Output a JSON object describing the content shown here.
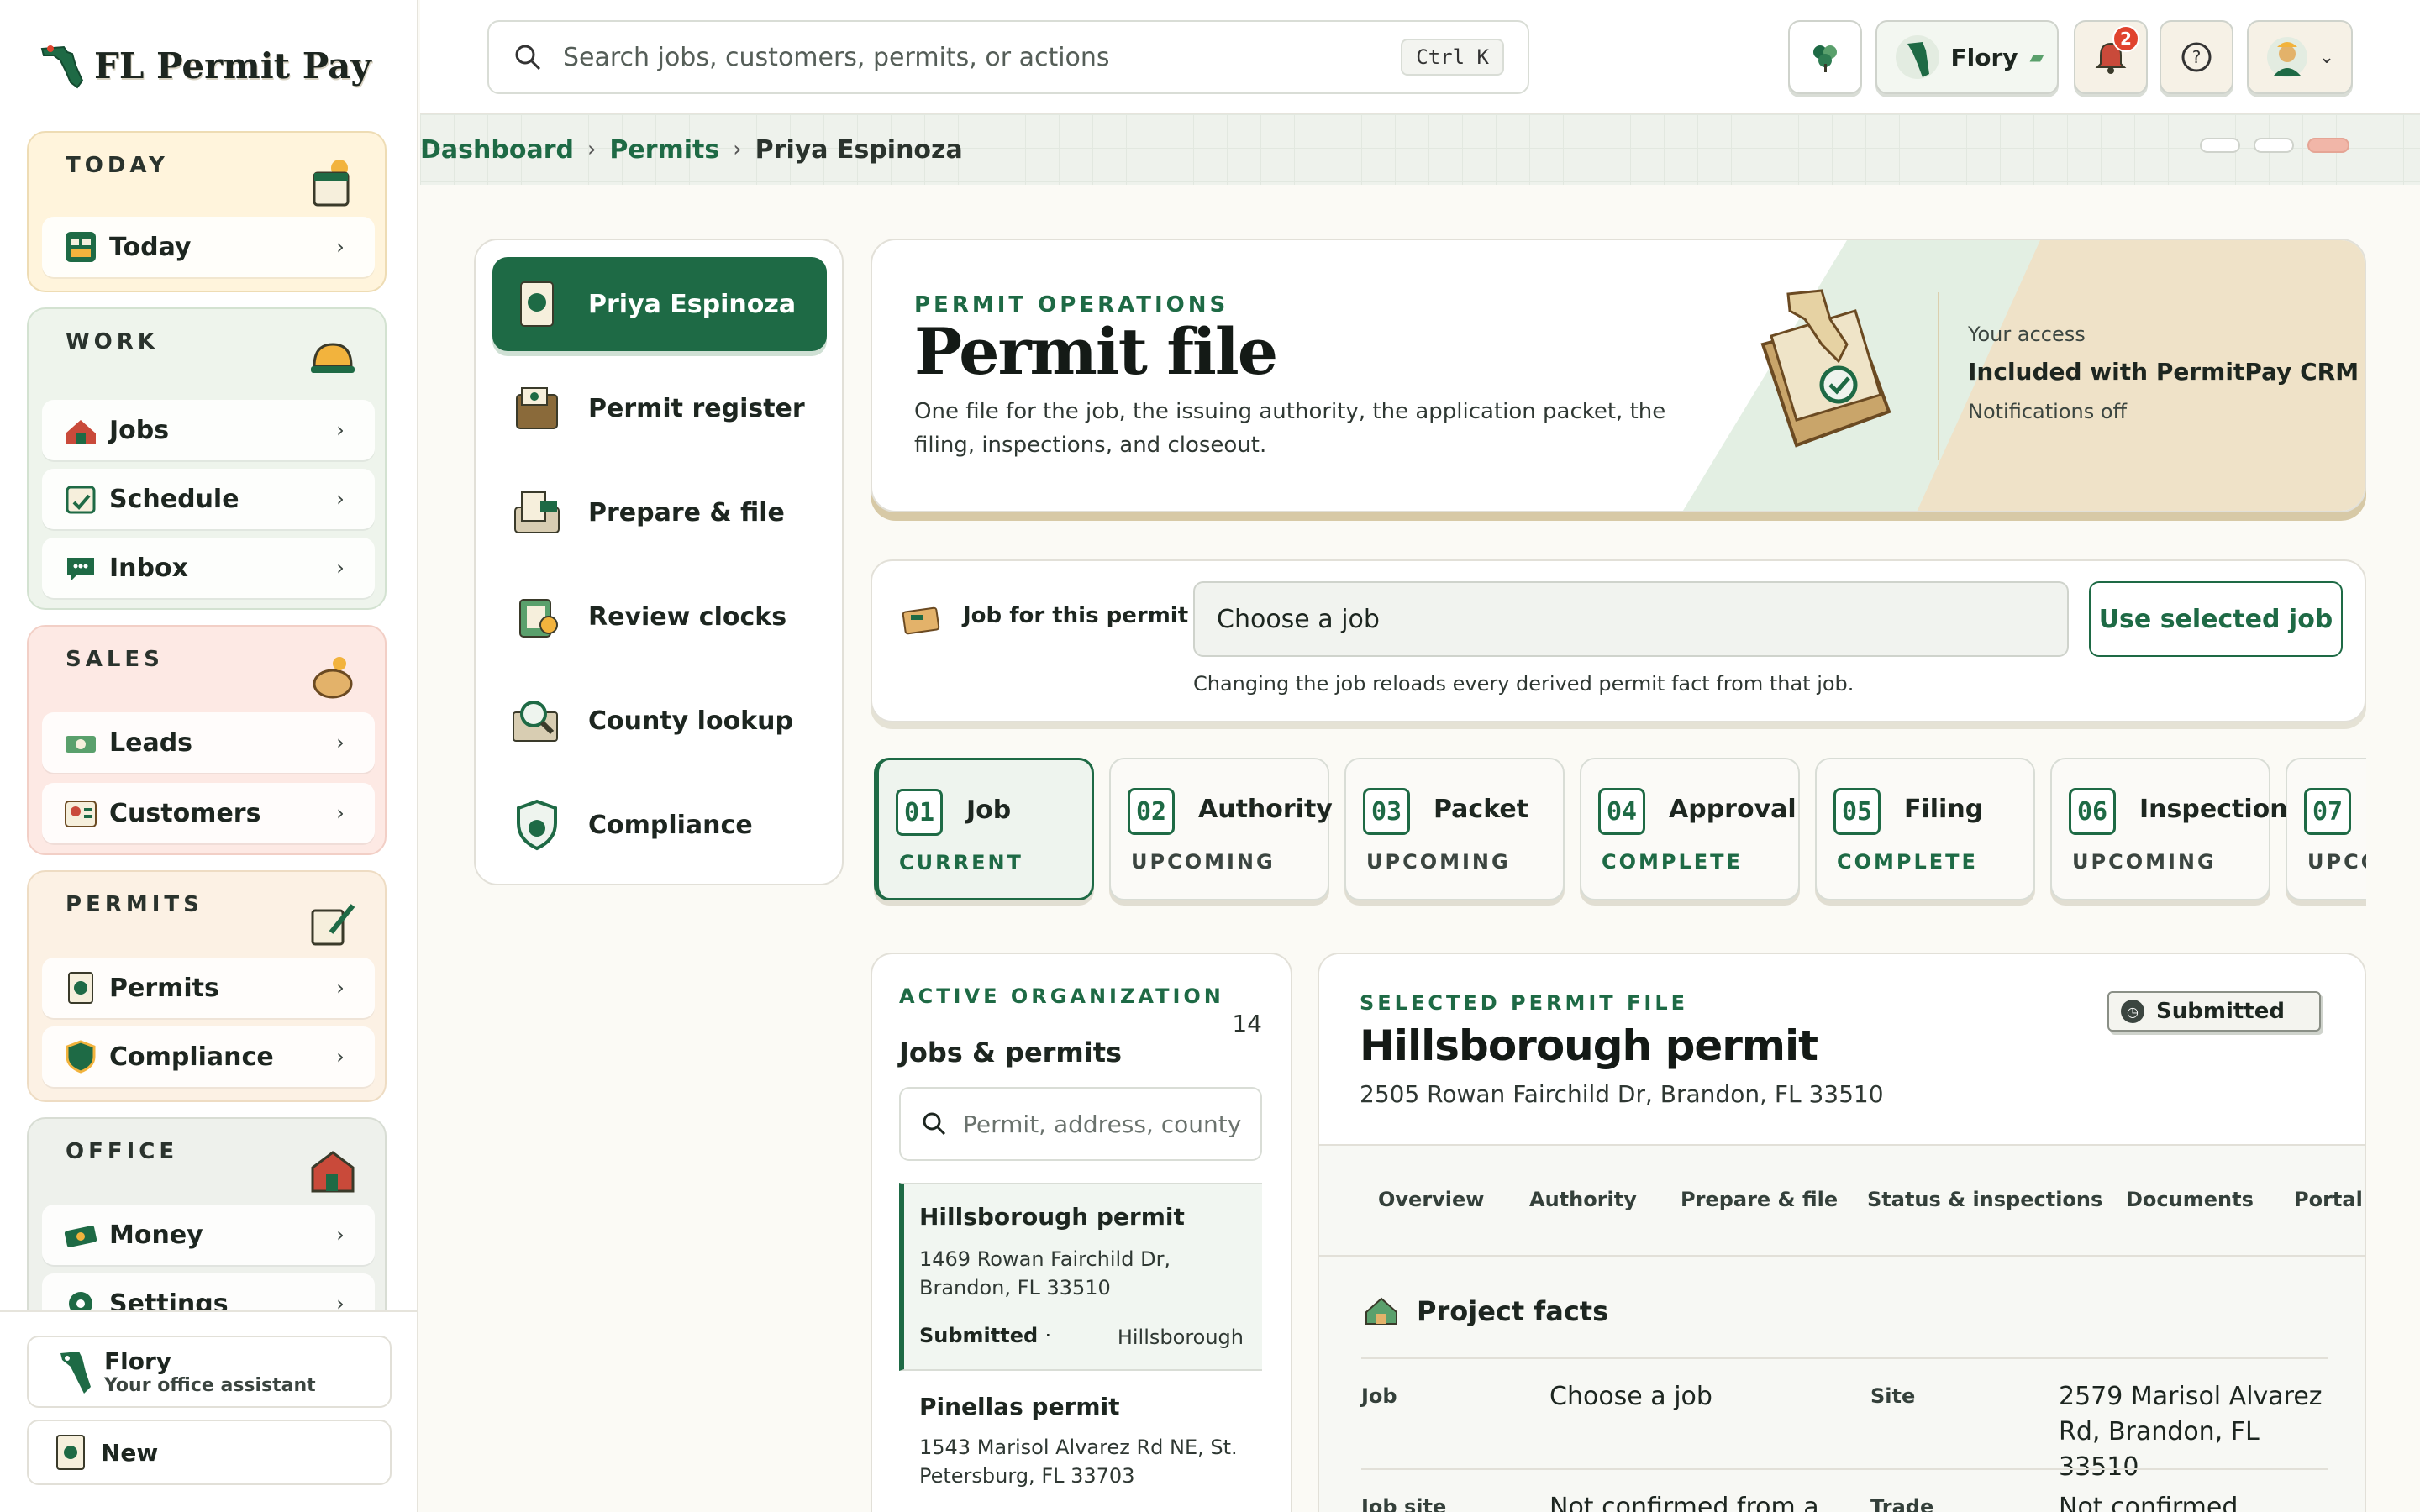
{
  "app": {
    "name": "FL Permit Pay"
  },
  "sidebar": {
    "groups": [
      {
        "title": "TODAY",
        "items": [
          {
            "label": "Today"
          }
        ]
      },
      {
        "title": "WORK",
        "items": [
          {
            "label": "Jobs"
          },
          {
            "label": "Schedule"
          },
          {
            "label": "Inbox"
          }
        ]
      },
      {
        "title": "SALES",
        "items": [
          {
            "label": "Leads"
          },
          {
            "label": "Customers"
          }
        ]
      },
      {
        "title": "PERMITS",
        "items": [
          {
            "label": "Permits"
          },
          {
            "label": "Compliance"
          }
        ]
      },
      {
        "title": "OFFICE",
        "items": [
          {
            "label": "Money"
          },
          {
            "label": "Settings"
          }
        ]
      }
    ],
    "assistant": {
      "name": "Flory",
      "subtitle": "Your office assistant"
    },
    "new_label": "New"
  },
  "topbar": {
    "search_placeholder": "Search jobs, customers, permits, or actions",
    "shortcut": "Ctrl K",
    "assistant_label": "Flory",
    "notification_count": "2"
  },
  "breadcrumb": {
    "items": [
      "Dashboard",
      "Permits"
    ],
    "current": "Priya Espinoza"
  },
  "subnav": {
    "items": [
      {
        "label": "Priya Espinoza",
        "active": true
      },
      {
        "label": "Permit register"
      },
      {
        "label": "Prepare & file"
      },
      {
        "label": "Review clocks"
      },
      {
        "label": "County lookup"
      },
      {
        "label": "Compliance"
      }
    ]
  },
  "hero": {
    "eyebrow": "PERMIT OPERATIONS",
    "title": "Permit file",
    "description": "One file for the job, the issuing authority, the application packet, the filing, inspections, and closeout.",
    "access_label": "Your access",
    "access_value": "Included with PermitPay CRM",
    "notifications": "Notifications off"
  },
  "job_selector": {
    "label": "Job for this permit",
    "value": "Choose a job",
    "button": "Use selected job",
    "hint": "Changing the job reloads every derived permit fact from that job."
  },
  "steps": [
    {
      "num": "01",
      "title": "Job",
      "status": "CURRENT"
    },
    {
      "num": "02",
      "title": "Authority",
      "status": "UPCOMING"
    },
    {
      "num": "03",
      "title": "Packet",
      "status": "UPCOMING"
    },
    {
      "num": "04",
      "title": "Approval",
      "status": "COMPLETE"
    },
    {
      "num": "05",
      "title": "Filing",
      "status": "COMPLETE"
    },
    {
      "num": "06",
      "title": "Inspection",
      "status": "UPCOMING"
    },
    {
      "num": "07",
      "title": "",
      "status": "UPCO"
    }
  ],
  "jobs_list": {
    "eyebrow": "ACTIVE ORGANIZATION",
    "title": "Jobs & permits",
    "count": "14",
    "search_placeholder": "Permit, address, county",
    "items": [
      {
        "title": "Hillsborough permit",
        "address": "1469 Rowan Fairchild Dr, Brandon, FL 33510",
        "status": "Submitted",
        "dot": "·",
        "county": "Hillsborough",
        "selected": true
      },
      {
        "title": "Pinellas permit",
        "address": "1543 Marisol Alvarez Rd NE, St. Petersburg, FL 33703"
      }
    ]
  },
  "detail": {
    "eyebrow": "SELECTED PERMIT FILE",
    "title": "Hillsborough permit",
    "address": "2505 Rowan Fairchild Dr, Brandon, FL 33510",
    "status": "Submitted",
    "tabs": [
      "Overview",
      "Authority",
      "Prepare & file",
      "Status & inspections",
      "Documents",
      "Portal a"
    ],
    "section_title": "Project facts",
    "facts": [
      {
        "k1": "Job",
        "v1": "Choose a job",
        "k2": "Site",
        "v2": "2579 Marisol Alvarez Rd, Brandon, FL 33510"
      },
      {
        "k1": "Job site",
        "v1": "Not confirmed from a",
        "k2": "Trade",
        "v2": "Not confirmed"
      }
    ]
  },
  "colors": {
    "brand": "#1e6a45",
    "complete": "#1e6a45",
    "upcoming": "#3b4540",
    "notification": "#e0432e"
  }
}
